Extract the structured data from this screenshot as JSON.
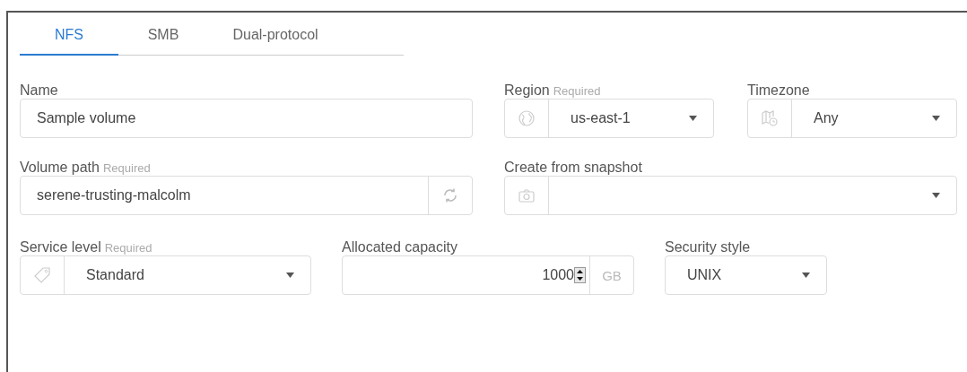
{
  "tabs": [
    {
      "label": "NFS",
      "selected": true
    },
    {
      "label": "SMB",
      "selected": false
    },
    {
      "label": "Dual-protocol",
      "selected": false
    }
  ],
  "rows": [
    [
      {
        "kind": "text",
        "label": "Name",
        "value": "Sample volume"
      },
      {
        "kind": "select",
        "label": "Region",
        "note": "Required",
        "value": "us-east-1"
      },
      {
        "kind": "select",
        "label": "Timezone",
        "value": "Any"
      }
    ],
    [
      {
        "kind": "refresh",
        "label": "Volume path",
        "note": "Required",
        "value": "serene-trusting-malcolm"
      },
      {
        "kind": "select",
        "label": "Create from snapshot"
      }
    ],
    [
      {
        "kind": "select",
        "label": "Service level",
        "note": "Required",
        "value": "Standard"
      },
      {
        "kind": "number",
        "label": "Allocated capacity",
        "value": "1000",
        "unit": "GB"
      },
      {
        "kind": "plain-select",
        "label": "Security style",
        "value": "UNIX"
      }
    ]
  ]
}
